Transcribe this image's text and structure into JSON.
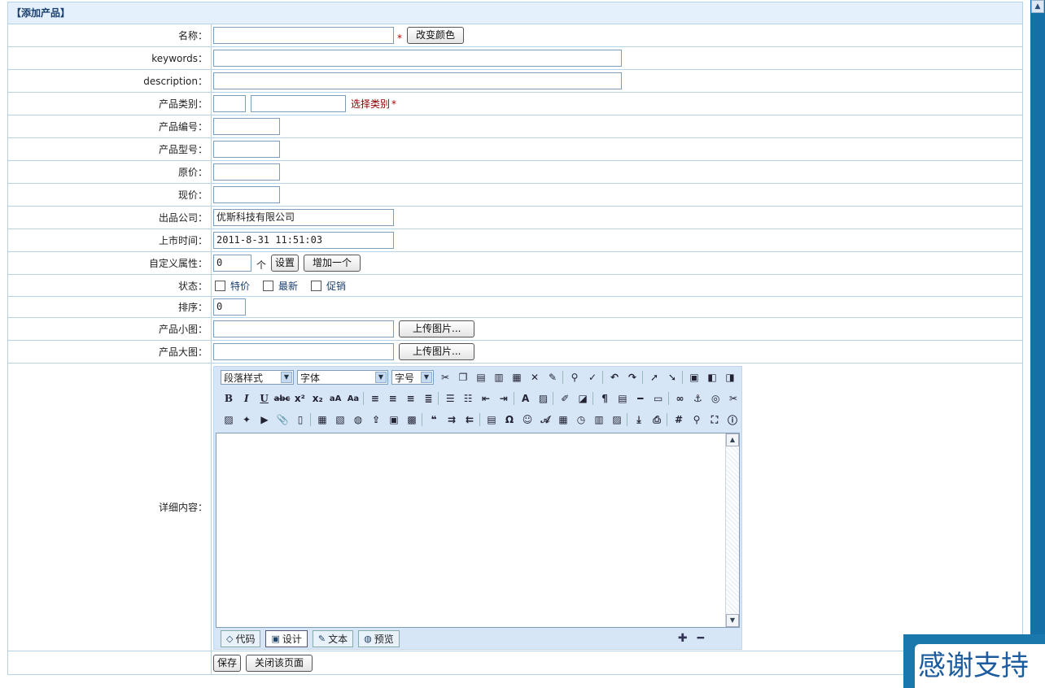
{
  "form": {
    "title": "【添加产品】",
    "fields": {
      "name": {
        "label": "名称：",
        "value": "",
        "required": "*",
        "color_button": "改变颜色"
      },
      "keywords": {
        "label": "keywords：",
        "value": ""
      },
      "description": {
        "label": "description：",
        "value": ""
      },
      "category": {
        "label": "产品类别：",
        "id_value": "",
        "name_value": "",
        "select_link": "选择类别",
        "required": "*"
      },
      "product_no": {
        "label": "产品编号：",
        "value": ""
      },
      "model_no": {
        "label": "产品型号：",
        "value": ""
      },
      "original_price": {
        "label": "原价：",
        "value": ""
      },
      "current_price": {
        "label": "现价：",
        "value": ""
      },
      "company": {
        "label": "出品公司：",
        "value": "优斯科技有限公司"
      },
      "release_time": {
        "label": "上市时间：",
        "value": "2011-8-31 11:51:03"
      },
      "custom_attr": {
        "label": "自定义属性：",
        "value": "0",
        "unit": "个",
        "set_button": "设置",
        "add_button": "增加一个"
      },
      "status": {
        "label": "状态：",
        "options": [
          "特价",
          "最新",
          "促销"
        ]
      },
      "sort": {
        "label": "排序：",
        "value": "0"
      },
      "small_image": {
        "label": "产品小图：",
        "value": "",
        "upload_button": "上传图片..."
      },
      "large_image": {
        "label": "产品大图：",
        "value": "",
        "upload_button": "上传图片..."
      },
      "detail": {
        "label": "详细内容："
      }
    },
    "actions": {
      "save": "保存",
      "close": "关闭该页面"
    }
  },
  "editor": {
    "paragraph_style": "段落样式",
    "font": "字体",
    "font_size": "字号",
    "modes": {
      "code": "代码",
      "design": "设计",
      "text": "文本",
      "preview": "预览"
    }
  },
  "badge": {
    "text": "感谢支持"
  },
  "colors": {
    "border": "#b6d3e6",
    "title_bg": "#e4f0fb",
    "editor_bg": "#d6e6f6",
    "accent": "#1b78ad"
  }
}
